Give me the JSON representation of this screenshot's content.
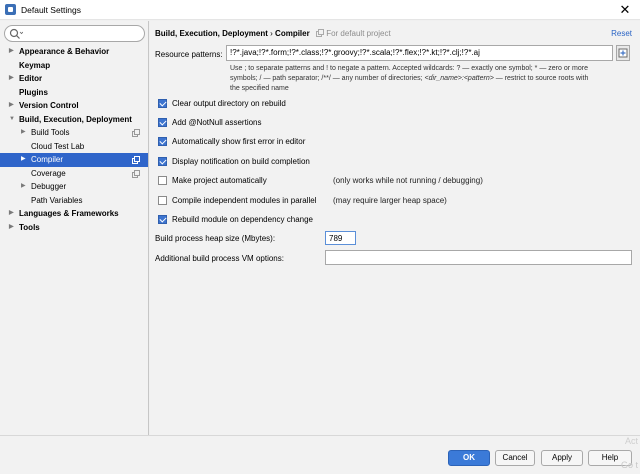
{
  "window": {
    "title": "Default Settings",
    "close_glyph": "✕"
  },
  "search": {
    "placeholder": "",
    "icon": "search-icon"
  },
  "sidebar": {
    "items": [
      {
        "label": "Appearance & Behavior",
        "arrow": "▶"
      },
      {
        "label": "Keymap"
      },
      {
        "label": "Editor",
        "arrow": "▶"
      },
      {
        "label": "Plugins"
      },
      {
        "label": "Version Control",
        "arrow": "▶"
      },
      {
        "label": "Build, Execution, Deployment",
        "arrow": "▼"
      },
      {
        "label": "Build Tools",
        "arrow": "▶"
      },
      {
        "label": "Cloud Test Lab"
      },
      {
        "label": "Compiler",
        "arrow": "▶",
        "selected": true
      },
      {
        "label": "Coverage"
      },
      {
        "label": "Debugger",
        "arrow": "▶"
      },
      {
        "label": "Path Variables"
      },
      {
        "label": "Languages & Frameworks",
        "arrow": "▶"
      },
      {
        "label": "Tools",
        "arrow": "▶"
      }
    ]
  },
  "header": {
    "crumb1": "Build, Execution, Deployment",
    "sep": "›",
    "crumb2": "Compiler",
    "for_default": "For default project",
    "reset": "Reset"
  },
  "resource": {
    "label": "Resource patterns:",
    "value": "!?*.java;!?*.form;!?*.class;!?*.groovy;!?*.scala;!?*.flex;!?*.kt;!?*.clj;!?*.aj",
    "hint1": "Use ; to separate patterns and ! to negate a pattern. Accepted wildcards: ? — exactly one symbol; * — zero or more",
    "hint2": "symbols; / — path separator; /**/ — any number of directories; ",
    "hint2_dir": "<dir_name>:<pattern>",
    "hint2_tail": " — restrict to source roots with",
    "hint3": "the specified name"
  },
  "options": {
    "clear_output": {
      "label": "Clear output directory on rebuild",
      "checked": true
    },
    "not_null": {
      "label": "Add @NotNull assertions",
      "checked": true
    },
    "show_error": {
      "label": "Automatically show first error in editor",
      "checked": true
    },
    "notify": {
      "label": "Display notification on build completion",
      "checked": true
    },
    "make_auto": {
      "label": "Make project automatically",
      "checked": false,
      "note": "(only works while not running / debugging)"
    },
    "parallel": {
      "label": "Compile independent modules in parallel",
      "checked": false,
      "note": "(may require larger heap space)"
    },
    "rebuild_dep": {
      "label": "Rebuild module on dependency change",
      "checked": true
    }
  },
  "heap": {
    "label": "Build process heap size (Mbytes):",
    "value": "789"
  },
  "vm": {
    "label": "Additional build process VM options:",
    "value": ""
  },
  "footer": {
    "ok": "OK",
    "cancel": "Cancel",
    "apply": "Apply",
    "help": "Help",
    "watermark_top": "Act",
    "watermark_bottom": "Go t"
  },
  "colors": {
    "selection": "#2f65ca",
    "link": "#2a64c5",
    "checkbox": "#3d74cf",
    "primary_button": "#3b7ad8"
  }
}
